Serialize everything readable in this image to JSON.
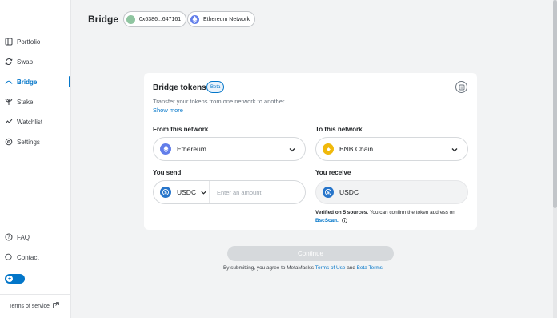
{
  "sidebar": {
    "items": [
      {
        "label": "Portfolio",
        "icon": "portfolio-icon"
      },
      {
        "label": "Swap",
        "icon": "swap-icon"
      },
      {
        "label": "Bridge",
        "icon": "bridge-icon",
        "active": true
      },
      {
        "label": "Stake",
        "icon": "stake-icon"
      },
      {
        "label": "Watchlist",
        "icon": "watchlist-icon"
      },
      {
        "label": "Settings",
        "icon": "settings-icon"
      }
    ],
    "bottom_items": [
      {
        "label": "FAQ",
        "icon": "help-icon"
      },
      {
        "label": "Contact",
        "icon": "chat-icon"
      }
    ],
    "toggle_on": true,
    "footer": {
      "terms_label": "Terms of service",
      "icon": "external-link-icon"
    }
  },
  "header": {
    "title": "Bridge",
    "account_label": "0x6386...647161",
    "network_label": "Ethereum Network"
  },
  "bridge": {
    "title": "Bridge tokens",
    "badge": "Beta",
    "subtitle": "Transfer your tokens from one network to another.",
    "show_more": "Show more",
    "from_label": "From this network",
    "from_network": "Ethereum",
    "to_label": "To this network",
    "to_network": "BNB Chain",
    "send_label": "You send",
    "send_token": "USDC",
    "amount_placeholder": "Enter an amount",
    "receive_label": "You receive",
    "receive_token": "USDC",
    "verify_bold": "Verified on 5 sources.",
    "verify_text": " You can confirm the token address on",
    "verify_link": "BscScan.",
    "info_icon": "info-icon"
  },
  "footer": {
    "continue_label": "Continue",
    "terms_prefix": "By submitting, you agree to MetaMask's ",
    "terms_of_use": "Terms of Use",
    "and": " and ",
    "beta_terms": "Beta Terms"
  },
  "colors": {
    "accent": "#0376c9",
    "background": "#f2f3f4",
    "ethereum": "#627eea",
    "bnb": "#f0b90b",
    "usdc": "#2775ca",
    "disabled_button": "#d6d9dc"
  }
}
